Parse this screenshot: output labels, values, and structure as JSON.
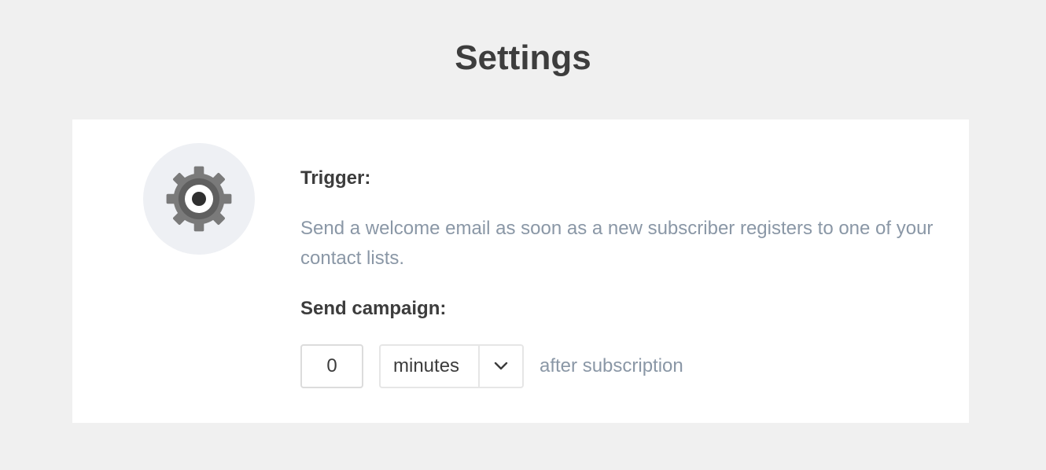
{
  "page": {
    "title": "Settings"
  },
  "trigger": {
    "label": "Trigger:",
    "description": "Send a welcome email as soon as a new subscriber registers to one of your contact lists."
  },
  "send_campaign": {
    "label": "Send campaign:",
    "delay_value": "0",
    "unit_selected": "minutes",
    "suffix": "after subscription"
  },
  "icons": {
    "badge": "gear-icon",
    "dropdown": "chevron-down-icon"
  },
  "colors": {
    "background": "#f0f0f0",
    "card": "#ffffff",
    "heading_text": "#3d3d3d",
    "muted_text": "#8a97a6",
    "icon_badge": "#eef0f4",
    "gear": "#7a7a7a"
  }
}
